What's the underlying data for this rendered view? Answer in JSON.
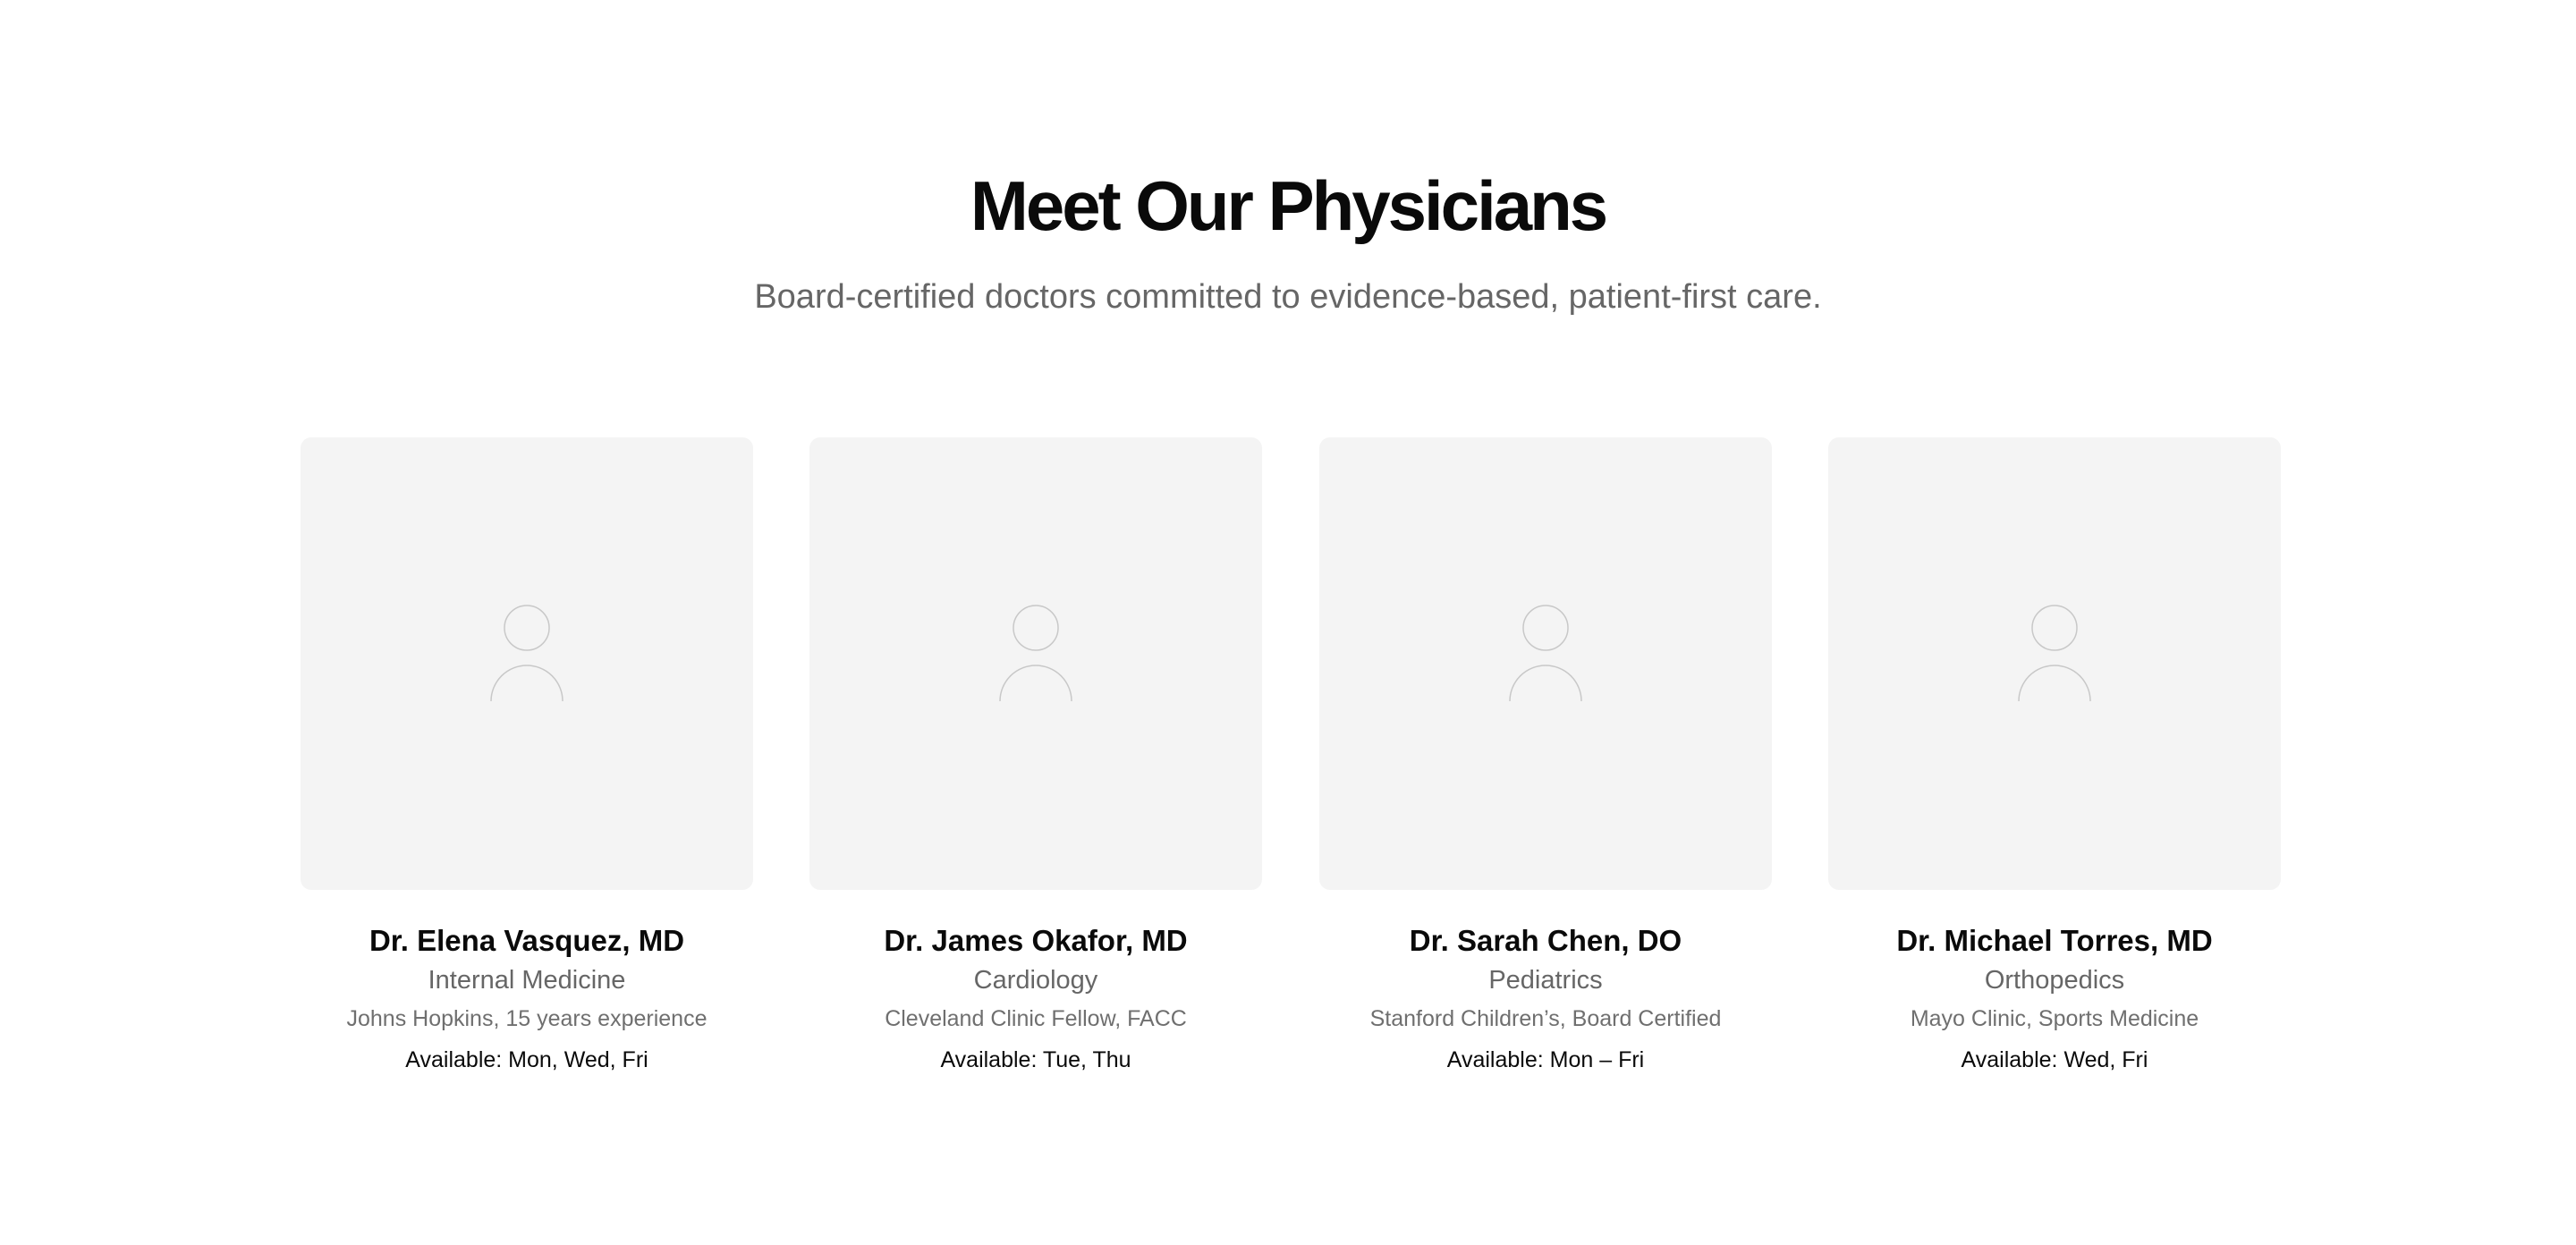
{
  "section": {
    "title": "Meet Our Physicians",
    "subtitle": "Board-certified doctors committed to evidence-based, patient-first care."
  },
  "physicians": [
    {
      "name": "Dr. Elena Vasquez, MD",
      "specialty": "Internal Medicine",
      "credentials": "Johns Hopkins, 15 years experience",
      "availability": "Available: Mon, Wed, Fri",
      "icon": "person-placeholder-icon"
    },
    {
      "name": "Dr. James Okafor, MD",
      "specialty": "Cardiology",
      "credentials": "Cleveland Clinic Fellow, FACC",
      "availability": "Available: Tue, Thu",
      "icon": "person-placeholder-icon"
    },
    {
      "name": "Dr. Sarah Chen, DO",
      "specialty": "Pediatrics",
      "credentials": "Stanford Children’s, Board Certified",
      "availability": "Available: Mon – Fri",
      "icon": "person-placeholder-icon"
    },
    {
      "name": "Dr. Michael Torres, MD",
      "specialty": "Orthopedics",
      "credentials": "Mayo Clinic, Sports Medicine",
      "availability": "Available: Wed, Fri",
      "icon": "person-placeholder-icon"
    }
  ],
  "colors": {
    "text": "#0a0a0a",
    "muted": "#666666",
    "card_bg": "#f4f4f4",
    "icon_stroke": "#c8c8c8"
  }
}
